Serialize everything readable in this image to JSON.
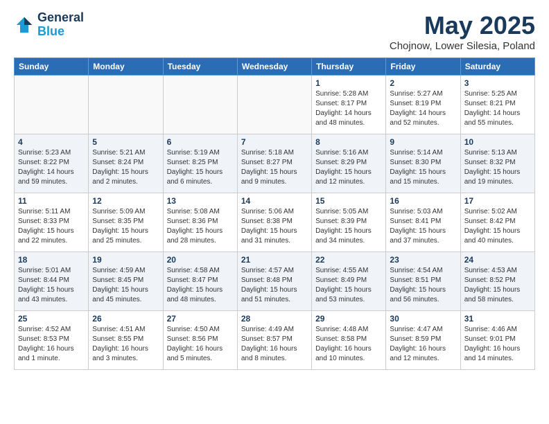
{
  "header": {
    "logo_line1": "General",
    "logo_line2": "Blue",
    "title": "May 2025",
    "subtitle": "Chojnow, Lower Silesia, Poland"
  },
  "weekdays": [
    "Sunday",
    "Monday",
    "Tuesday",
    "Wednesday",
    "Thursday",
    "Friday",
    "Saturday"
  ],
  "weeks": [
    [
      {
        "num": "",
        "info": ""
      },
      {
        "num": "",
        "info": ""
      },
      {
        "num": "",
        "info": ""
      },
      {
        "num": "",
        "info": ""
      },
      {
        "num": "1",
        "info": "Sunrise: 5:28 AM\nSunset: 8:17 PM\nDaylight: 14 hours\nand 48 minutes."
      },
      {
        "num": "2",
        "info": "Sunrise: 5:27 AM\nSunset: 8:19 PM\nDaylight: 14 hours\nand 52 minutes."
      },
      {
        "num": "3",
        "info": "Sunrise: 5:25 AM\nSunset: 8:21 PM\nDaylight: 14 hours\nand 55 minutes."
      }
    ],
    [
      {
        "num": "4",
        "info": "Sunrise: 5:23 AM\nSunset: 8:22 PM\nDaylight: 14 hours\nand 59 minutes."
      },
      {
        "num": "5",
        "info": "Sunrise: 5:21 AM\nSunset: 8:24 PM\nDaylight: 15 hours\nand 2 minutes."
      },
      {
        "num": "6",
        "info": "Sunrise: 5:19 AM\nSunset: 8:25 PM\nDaylight: 15 hours\nand 6 minutes."
      },
      {
        "num": "7",
        "info": "Sunrise: 5:18 AM\nSunset: 8:27 PM\nDaylight: 15 hours\nand 9 minutes."
      },
      {
        "num": "8",
        "info": "Sunrise: 5:16 AM\nSunset: 8:29 PM\nDaylight: 15 hours\nand 12 minutes."
      },
      {
        "num": "9",
        "info": "Sunrise: 5:14 AM\nSunset: 8:30 PM\nDaylight: 15 hours\nand 15 minutes."
      },
      {
        "num": "10",
        "info": "Sunrise: 5:13 AM\nSunset: 8:32 PM\nDaylight: 15 hours\nand 19 minutes."
      }
    ],
    [
      {
        "num": "11",
        "info": "Sunrise: 5:11 AM\nSunset: 8:33 PM\nDaylight: 15 hours\nand 22 minutes."
      },
      {
        "num": "12",
        "info": "Sunrise: 5:09 AM\nSunset: 8:35 PM\nDaylight: 15 hours\nand 25 minutes."
      },
      {
        "num": "13",
        "info": "Sunrise: 5:08 AM\nSunset: 8:36 PM\nDaylight: 15 hours\nand 28 minutes."
      },
      {
        "num": "14",
        "info": "Sunrise: 5:06 AM\nSunset: 8:38 PM\nDaylight: 15 hours\nand 31 minutes."
      },
      {
        "num": "15",
        "info": "Sunrise: 5:05 AM\nSunset: 8:39 PM\nDaylight: 15 hours\nand 34 minutes."
      },
      {
        "num": "16",
        "info": "Sunrise: 5:03 AM\nSunset: 8:41 PM\nDaylight: 15 hours\nand 37 minutes."
      },
      {
        "num": "17",
        "info": "Sunrise: 5:02 AM\nSunset: 8:42 PM\nDaylight: 15 hours\nand 40 minutes."
      }
    ],
    [
      {
        "num": "18",
        "info": "Sunrise: 5:01 AM\nSunset: 8:44 PM\nDaylight: 15 hours\nand 43 minutes."
      },
      {
        "num": "19",
        "info": "Sunrise: 4:59 AM\nSunset: 8:45 PM\nDaylight: 15 hours\nand 45 minutes."
      },
      {
        "num": "20",
        "info": "Sunrise: 4:58 AM\nSunset: 8:47 PM\nDaylight: 15 hours\nand 48 minutes."
      },
      {
        "num": "21",
        "info": "Sunrise: 4:57 AM\nSunset: 8:48 PM\nDaylight: 15 hours\nand 51 minutes."
      },
      {
        "num": "22",
        "info": "Sunrise: 4:55 AM\nSunset: 8:49 PM\nDaylight: 15 hours\nand 53 minutes."
      },
      {
        "num": "23",
        "info": "Sunrise: 4:54 AM\nSunset: 8:51 PM\nDaylight: 15 hours\nand 56 minutes."
      },
      {
        "num": "24",
        "info": "Sunrise: 4:53 AM\nSunset: 8:52 PM\nDaylight: 15 hours\nand 58 minutes."
      }
    ],
    [
      {
        "num": "25",
        "info": "Sunrise: 4:52 AM\nSunset: 8:53 PM\nDaylight: 16 hours\nand 1 minute."
      },
      {
        "num": "26",
        "info": "Sunrise: 4:51 AM\nSunset: 8:55 PM\nDaylight: 16 hours\nand 3 minutes."
      },
      {
        "num": "27",
        "info": "Sunrise: 4:50 AM\nSunset: 8:56 PM\nDaylight: 16 hours\nand 5 minutes."
      },
      {
        "num": "28",
        "info": "Sunrise: 4:49 AM\nSunset: 8:57 PM\nDaylight: 16 hours\nand 8 minutes."
      },
      {
        "num": "29",
        "info": "Sunrise: 4:48 AM\nSunset: 8:58 PM\nDaylight: 16 hours\nand 10 minutes."
      },
      {
        "num": "30",
        "info": "Sunrise: 4:47 AM\nSunset: 8:59 PM\nDaylight: 16 hours\nand 12 minutes."
      },
      {
        "num": "31",
        "info": "Sunrise: 4:46 AM\nSunset: 9:01 PM\nDaylight: 16 hours\nand 14 minutes."
      }
    ]
  ]
}
